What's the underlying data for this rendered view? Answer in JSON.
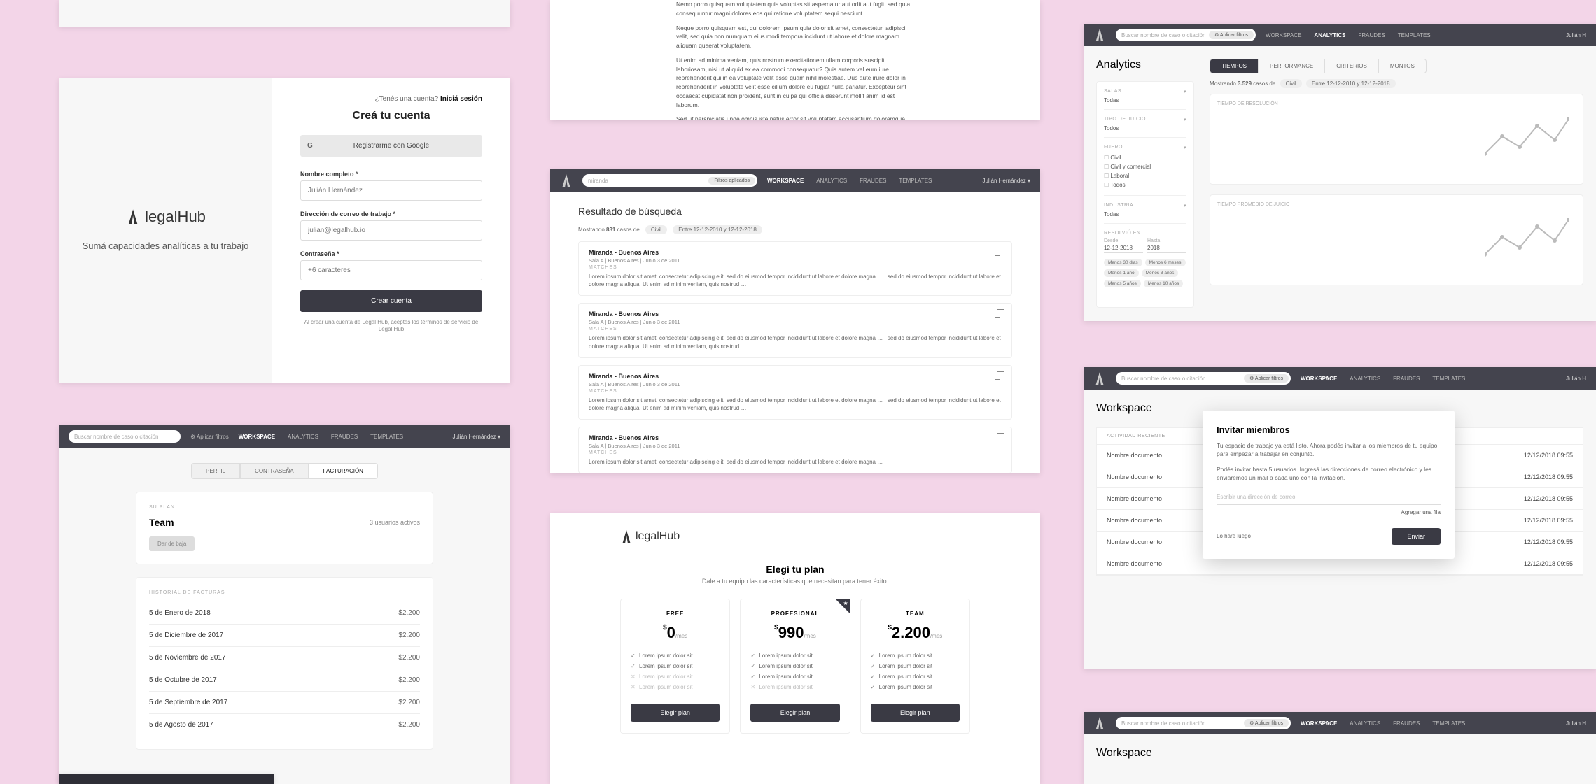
{
  "brand": "legalHub",
  "topnav": {
    "items": [
      "WORKSPACE",
      "ANALYTICS",
      "FRAUDES",
      "TEMPLATES"
    ],
    "user": "Julián Hernández",
    "search_ph": "Buscar nombre de caso o citación",
    "filters": "Aplicar filtros",
    "filters_applied": "Filtros aplicados"
  },
  "signup": {
    "have_account": "¿Tenés una cuenta?",
    "login": "Iniciá sesión",
    "title": "Creá tu cuenta",
    "google": "Registrarme con Google",
    "name_lbl": "Nombre completo *",
    "name_ph": "Julián Hernández",
    "email_lbl": "Dirección de correo de trabajo *",
    "email_ph": "julian@legalhub.io",
    "pass_lbl": "Contraseña *",
    "pass_ph": "+6 caracteres",
    "submit": "Crear cuenta",
    "terms": "Al crear una cuenta de Legal Hub, aceptás los términos de servicio de Legal Hub",
    "tagline": "Sumá capacidades analíticas a tu trabajo"
  },
  "doc": {
    "p1": "Nemo porro quisquam voluptatem quia voluptas sit aspernatur aut odit aut fugit, sed quia consequuntur magni dolores eos qui ratione voluptatem sequi nesciunt.",
    "p2": "Neque porro quisquam est, qui dolorem ipsum quia dolor sit amet, consectetur, adipisci velit, sed quia non numquam eius modi tempora incidunt ut labore et dolore magnam aliquam quaerat voluptatem.",
    "p3": "Ut enim ad minima veniam, quis nostrum exercitationem ullam corporis suscipit laboriosam, nisi ut aliquid ex ea commodi consequatur? Quis autem vel eum iure reprehenderit qui in ea voluptate velit esse quam nihil molestiae. Dus aute irure dolor in reprehenderit in voluptate velit esse cillum dolore eu fugiat nulla pariatur. Excepteur sint occaecat cupidatat non proident, sunt in culpa qui officia deserunt mollit anim id est laborum.",
    "p4": "Sed ut perspiciatis unde omnis iste natus error sit voluptatem accusantium doloremque laudantium, totam rem aperiam, eaque ipsa quae ab illo inventore veritatis et quasi architecto beatae vitae dicta sunt explicabo."
  },
  "search": {
    "query": "miranda",
    "title": "Resultado de búsqueda",
    "meta_pre": "Mostrando",
    "meta_count": "831",
    "meta_post": "casos de",
    "chip1": "Civil",
    "chip2": "Entre 12-12-2010 y 12-12-2018",
    "results": [
      {
        "title": "Miranda - Buenos Aires",
        "sub": "Sala A | Buenos Aires | Junio 3 de 2011",
        "tag": "MATCHES",
        "txt": "Lorem ipsum dolor sit amet, consectetur adipiscing elit, sed do eiusmod tempor incididunt ut labore et dolore magna … . sed do eiusmod tempor incididunt ut labore et dolore magna aliqua. Ut enim ad minim veniam, quis nostrud …"
      },
      {
        "title": "Miranda - Buenos Aires",
        "sub": "Sala A | Buenos Aires | Junio 3 de 2011",
        "tag": "MATCHES",
        "txt": "Lorem ipsum dolor sit amet, consectetur adipiscing elit, sed do eiusmod tempor incididunt ut labore et dolore magna … . sed do eiusmod tempor incididunt ut labore et dolore magna aliqua. Ut enim ad minim veniam, quis nostrud …"
      },
      {
        "title": "Miranda - Buenos Aires",
        "sub": "Sala A | Buenos Aires | Junio 3 de 2011",
        "tag": "MATCHES",
        "txt": "Lorem ipsum dolor sit amet, consectetur adipiscing elit, sed do eiusmod tempor incididunt ut labore et dolore magna … . sed do eiusmod tempor incididunt ut labore et dolore magna aliqua. Ut enim ad minim veniam, quis nostrud …"
      },
      {
        "title": "Miranda - Buenos Aires",
        "sub": "Sala A | Buenos Aires | Junio 3 de 2011",
        "tag": "MATCHES",
        "txt": "Lorem ipsum dolor sit amet, consectetur adipiscing elit, sed do eiusmod tempor incididunt ut labore et dolore magna …"
      }
    ]
  },
  "billing": {
    "tabs": [
      "PERFIL",
      "CONTRASEÑA",
      "FACTURACIÓN"
    ],
    "plan_lbl": "SU PLAN",
    "plan": "Team",
    "users": "3 usuarios activos",
    "unsub": "Dar de baja",
    "hist_lbl": "HISTORIAL DE FACTURAS",
    "invoices": [
      {
        "d": "5 de Enero de 2018",
        "a": "$2.200"
      },
      {
        "d": "5 de Diciembre de 2017",
        "a": "$2.200"
      },
      {
        "d": "5 de Noviembre de 2017",
        "a": "$2.200"
      },
      {
        "d": "5 de Octubre de 2017",
        "a": "$2.200"
      },
      {
        "d": "5 de Septiembre de 2017",
        "a": "$2.200"
      },
      {
        "d": "5 de Agosto de 2017",
        "a": "$2.200"
      }
    ]
  },
  "pricing": {
    "title": "Elegí tu plan",
    "sub": "Dale a tu equipo las características que necesitan para tener éxito.",
    "btn": "Elegir plan",
    "feat": "Lorem ipsum dolor sit",
    "plans": [
      {
        "name": "FREE",
        "price": "0",
        "per": "/mes",
        "feats": [
          true,
          true,
          false,
          false
        ]
      },
      {
        "name": "PROFESIONAL",
        "price": "990",
        "per": "/mes",
        "feats": [
          true,
          true,
          true,
          false
        ],
        "star": true
      },
      {
        "name": "TEAM",
        "price": "2.200",
        "per": "/mes",
        "feats": [
          true,
          true,
          true,
          true
        ]
      }
    ]
  },
  "analytics": {
    "title": "Analytics",
    "tabs": [
      "TIEMPOS",
      "PERFORMANCE",
      "CRITERIOS",
      "MONTOS"
    ],
    "meta_pre": "Mostrando",
    "meta_count": "3.529",
    "meta_post": "casos de",
    "chip1": "Civil",
    "chip2": "Entre 12-12-2010 y 12-12-2018",
    "filters": {
      "salas": {
        "l": "SALAS",
        "v": "Todas"
      },
      "tipo": {
        "l": "TIPO DE JUICIO",
        "v": "Todos"
      },
      "fuero": {
        "l": "FUERO",
        "items": [
          "Civil",
          "Civil y comercial",
          "Laboral",
          "Todos"
        ]
      },
      "industria": {
        "l": "INDUSTRIA",
        "v": "Todas"
      },
      "resuelto": {
        "l": "RESOLVIÓ EN",
        "desde": "Desde",
        "hasta": "Hasta",
        "d1": "12-12-2018",
        "d2": "2018"
      },
      "chips": [
        "Menos 30 días",
        "Menos 6 meses",
        "Menos 1 año",
        "Menos 3 años",
        "Menos 5 años",
        "Menos 10 años"
      ]
    },
    "chart1": "TIEMPO DE RESOLUCIÓN",
    "chart2": "TIEMPO PROMEDIO DE JUICIO"
  },
  "workspace": {
    "title": "Workspace",
    "hd": "ACTIVIDAD RECIENTE",
    "rows": [
      {
        "n": "Nombre documento",
        "d": "12/12/2018 09:55"
      },
      {
        "n": "Nombre documento",
        "d": "12/12/2018 09:55"
      },
      {
        "n": "Nombre documento",
        "d": "12/12/2018 09:55"
      },
      {
        "n": "Nombre documento",
        "d": "12/12/2018 09:55"
      },
      {
        "n": "Nombre documento",
        "d": "12/12/2018 09:55"
      },
      {
        "n": "Nombre documento",
        "d": "12/12/2018 09:55"
      }
    ],
    "modal": {
      "title": "Invitar miembros",
      "p1": "Tu espacio de trabajo ya está listo. Ahora podés invitar a los miembros de tu equipo para empezar a trabajar en conjunto.",
      "p2": "Podés invitar hasta 5 usuarios. Ingresá las direcciones de correo electrónico y les enviaremos un mail a cada uno con la invitación.",
      "ph": "Escribir una dirección de correo",
      "add": "Agregar una fila",
      "later": "Lo haré luego",
      "send": "Enviar"
    }
  }
}
